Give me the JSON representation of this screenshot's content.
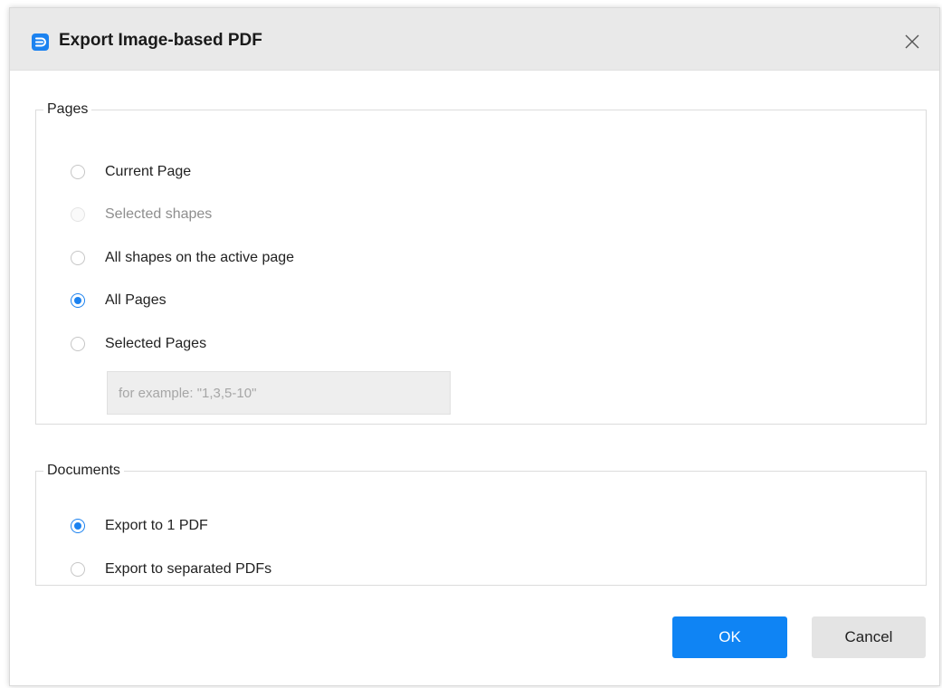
{
  "dialog": {
    "title": "Export Image-based PDF",
    "app_icon": "edraw-logo-icon",
    "close_icon": "close-icon"
  },
  "pages_group": {
    "legend": "Pages",
    "options": [
      {
        "label": "Current Page",
        "checked": false,
        "disabled": false
      },
      {
        "label": "Selected shapes",
        "checked": false,
        "disabled": true
      },
      {
        "label": "All shapes on the active page",
        "checked": false,
        "disabled": false
      },
      {
        "label": "All Pages",
        "checked": true,
        "disabled": false
      },
      {
        "label": "Selected Pages",
        "checked": false,
        "disabled": false
      }
    ],
    "page_range": {
      "value": "",
      "placeholder": "for example: \"1,3,5-10\""
    }
  },
  "documents_group": {
    "legend": "Documents",
    "options": [
      {
        "label": "Export to 1 PDF",
        "checked": true,
        "disabled": false
      },
      {
        "label": "Export to separated PDFs",
        "checked": false,
        "disabled": false
      }
    ]
  },
  "buttons": {
    "ok": "OK",
    "cancel": "Cancel"
  },
  "colors": {
    "accent": "#1b82f0",
    "primary_button": "#0f84f4",
    "secondary_button": "#e4e4e4",
    "titlebar": "#e9e9e9"
  }
}
